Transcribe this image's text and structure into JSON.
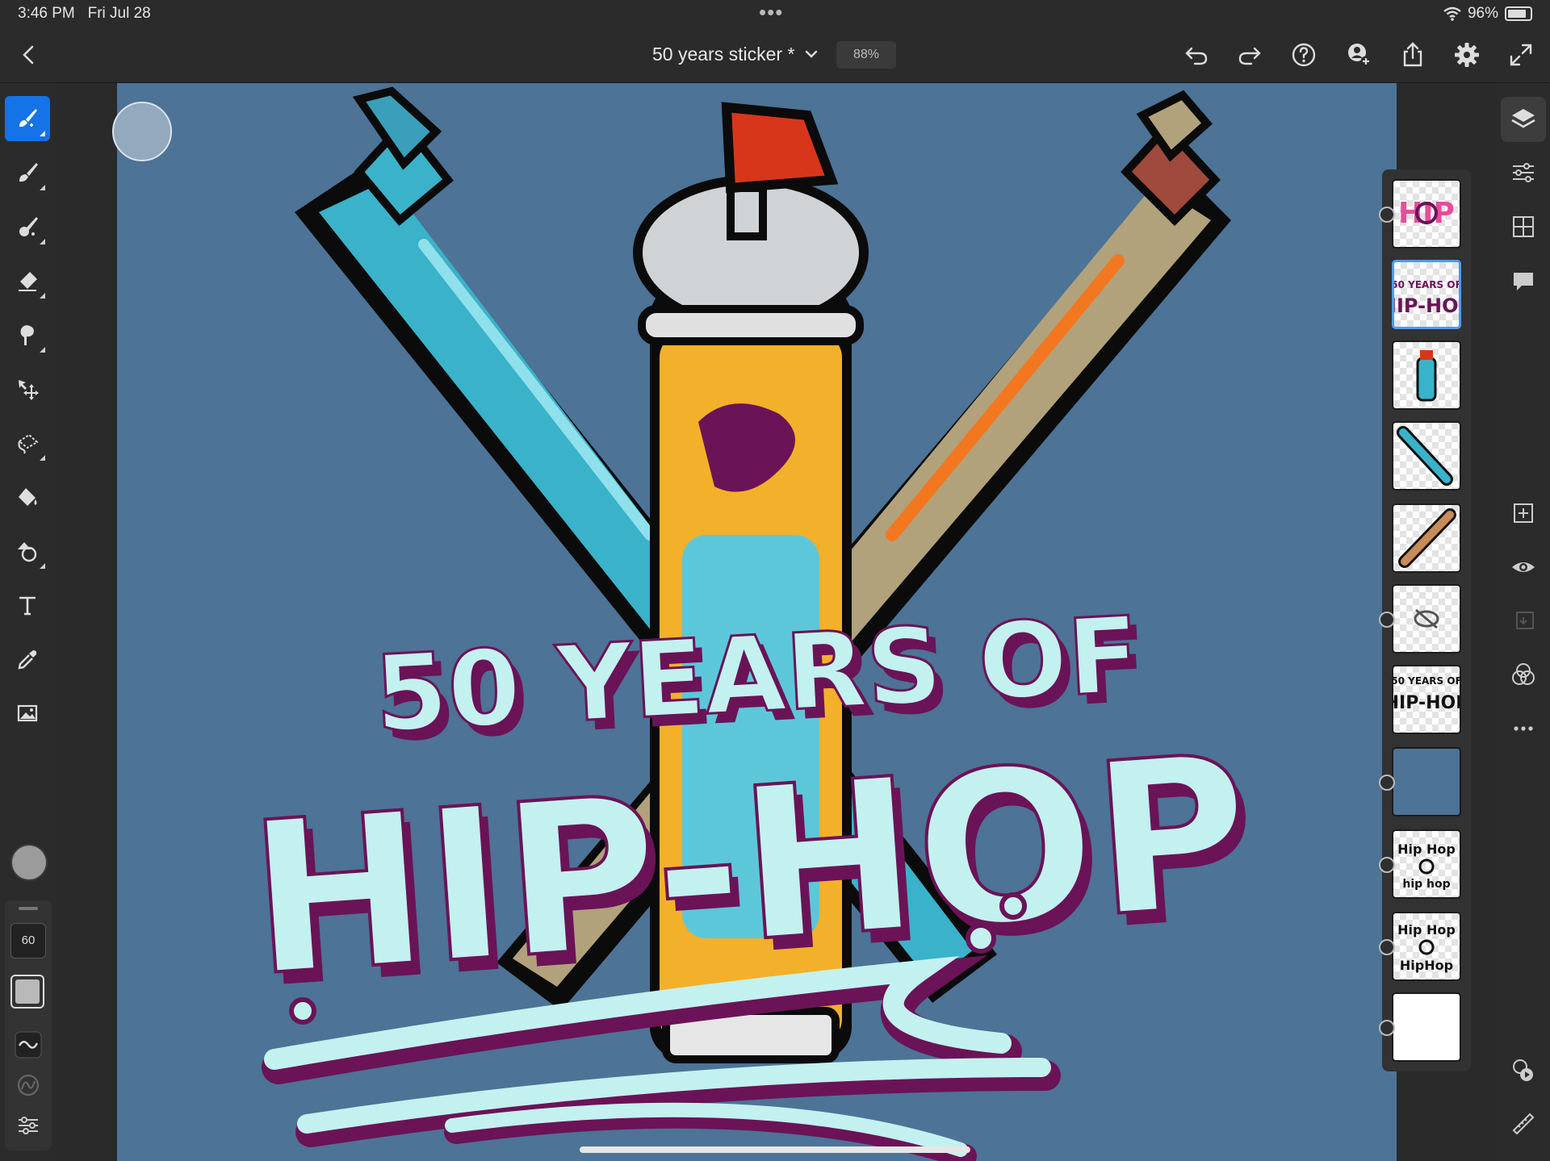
{
  "status_bar": {
    "time": "3:46 PM",
    "date": "Fri Jul 28",
    "battery": "96%",
    "dots": "•••"
  },
  "topbar": {
    "document_title": "50 years sticker *",
    "zoom": "88%",
    "icons": [
      "back-icon",
      "chevron-down-icon",
      "undo-icon",
      "redo-icon",
      "help-icon",
      "invite-icon",
      "share-icon",
      "settings-icon",
      "fullscreen-icon"
    ]
  },
  "tools": [
    "paint-brush-tool",
    "pixel-brush-tool",
    "live-brush-tool",
    "eraser-tool",
    "smudge-tool",
    "transform-tool",
    "selection-tool",
    "fill-tool",
    "shapes-tool",
    "text-tool",
    "eyedropper-tool",
    "image-tool"
  ],
  "brush_settings": {
    "size": "60"
  },
  "artwork": {
    "line1": "50 YEARS OF",
    "line2": "HIP-HOP",
    "colors": {
      "canvas": "#4d7396",
      "letters": "#c3f1ef",
      "shadow": "#6b1357",
      "cyan_can": "#3ab2c9",
      "tan_can": "#b1a27b",
      "orange": "#f3771f",
      "red_cap": "#d8361a"
    }
  },
  "layers_panel": {
    "layer_count": 11,
    "selected_index": 1
  },
  "right_rail_icons": [
    "layers-icon",
    "adjustments-icon",
    "grid-icon",
    "comments-icon",
    "add-layer-icon",
    "visibility-icon",
    "merge-icon",
    "blend-icon",
    "more-icon",
    "timelapse-icon",
    "ruler-icon"
  ]
}
